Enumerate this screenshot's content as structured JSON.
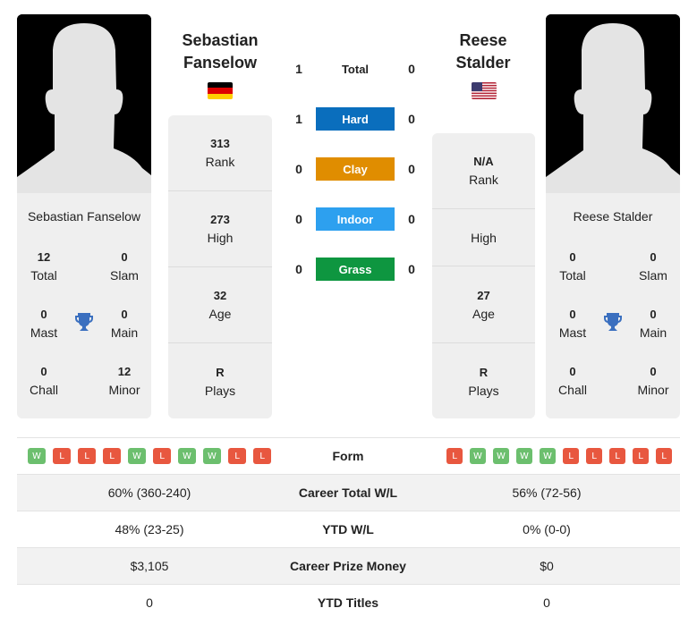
{
  "left": {
    "name": "Sebastian Fanselow",
    "title_line1": "Sebastian",
    "title_line2": "Fanselow",
    "flag": "germany-flag",
    "titles": {
      "total": "12",
      "slam": "0",
      "mast": "0",
      "main": "0",
      "chall": "0",
      "minor": "12"
    },
    "rank": "313",
    "high": "273",
    "age": "32",
    "plays": "R",
    "form": [
      "W",
      "L",
      "L",
      "L",
      "W",
      "L",
      "W",
      "W",
      "L",
      "L"
    ]
  },
  "right": {
    "name": "Reese Stalder",
    "title_line1": "Reese",
    "title_line2": "Stalder",
    "flag": "usa-flag",
    "titles": {
      "total": "0",
      "slam": "0",
      "mast": "0",
      "main": "0",
      "chall": "0",
      "minor": "0"
    },
    "rank": "N/A",
    "high": "",
    "age": "27",
    "plays": "R",
    "form": [
      "L",
      "W",
      "W",
      "W",
      "W",
      "L",
      "L",
      "L",
      "L",
      "L"
    ]
  },
  "labels": {
    "total": "Total",
    "slam": "Slam",
    "mast": "Mast",
    "main": "Main",
    "chall": "Chall",
    "minor": "Minor",
    "rank": "Rank",
    "high": "High",
    "age": "Age",
    "plays": "Plays",
    "form": "Form"
  },
  "h2h": [
    {
      "label": "Total",
      "left": "1",
      "right": "0",
      "color": ""
    },
    {
      "label": "Hard",
      "left": "1",
      "right": "0",
      "color": "#0a6ebd"
    },
    {
      "label": "Clay",
      "left": "0",
      "right": "0",
      "color": "#e08d00"
    },
    {
      "label": "Indoor",
      "left": "0",
      "right": "0",
      "color": "#2da0ef"
    },
    {
      "label": "Grass",
      "left": "0",
      "right": "0",
      "color": "#0e9640"
    }
  ],
  "table": [
    {
      "label": "Career Total W/L",
      "left": "60% (360-240)",
      "right": "56% (72-56)"
    },
    {
      "label": "YTD W/L",
      "left": "48% (23-25)",
      "right": "0% (0-0)"
    },
    {
      "label": "Career Prize Money",
      "left": "$3,105",
      "right": "$0"
    },
    {
      "label": "YTD Titles",
      "left": "0",
      "right": "0"
    }
  ]
}
